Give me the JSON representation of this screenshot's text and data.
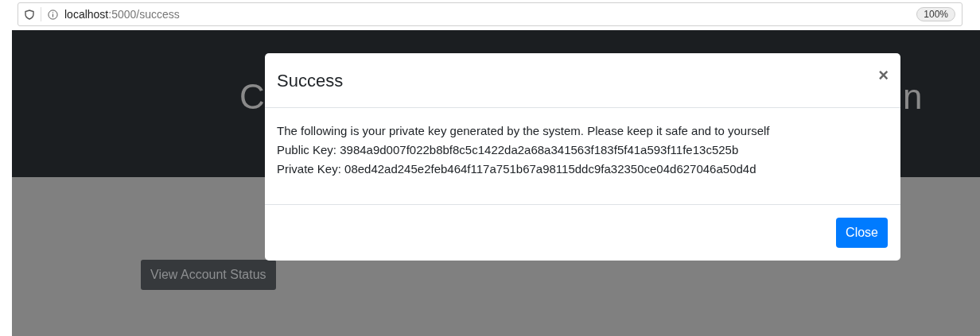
{
  "browser": {
    "url_host": "localhost",
    "url_path": ":5000/success",
    "zoom": "100%"
  },
  "page": {
    "heading_left_fragment": "C",
    "heading_right_fragment": "n",
    "button": "View Account Status"
  },
  "modal": {
    "title": "Success",
    "close_glyph": "×",
    "lines": [
      "The following is your private key generated by the system. Please keep it safe and to yourself",
      "Public Key: 3984a9d007f022b8bf8c5c1422da2a68a341563f183f5f41a593f11fe13c525b",
      "Private Key: 08ed42ad245e2feb464f117a751b67a98115ddc9fa32350ce04d627046a50d4d"
    ],
    "button": "Close"
  }
}
